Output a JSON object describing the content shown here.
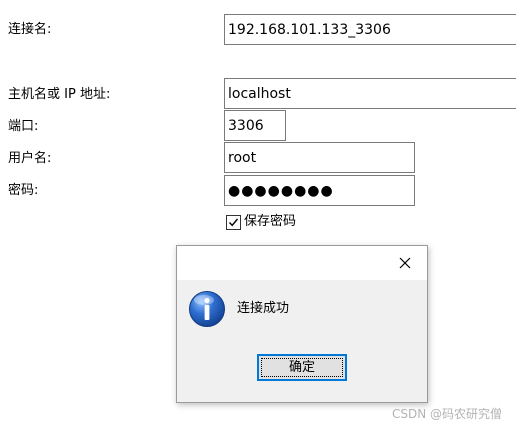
{
  "form": {
    "connection_name": {
      "label": "连接名:",
      "value": "192.168.101.133_3306"
    },
    "host": {
      "label": "主机名或 IP 地址:",
      "value": "localhost"
    },
    "port": {
      "label": "端口:",
      "value": "3306"
    },
    "username": {
      "label": "用户名:",
      "value": "root"
    },
    "password": {
      "label": "密码:",
      "value": "●●●●●●●●"
    },
    "save_password": {
      "label": "保存密码",
      "checked": true
    }
  },
  "dialog": {
    "message": "连接成功",
    "ok_label": "确定",
    "icon": "info-icon",
    "close_icon": "close-icon"
  },
  "watermark": "CSDN @码农研究僧",
  "colors": {
    "focus_border": "#0078d7",
    "button_bg": "#e1e1e1",
    "dialog_bg": "#f0f0f0",
    "info_blue": "#1e5bb8"
  }
}
